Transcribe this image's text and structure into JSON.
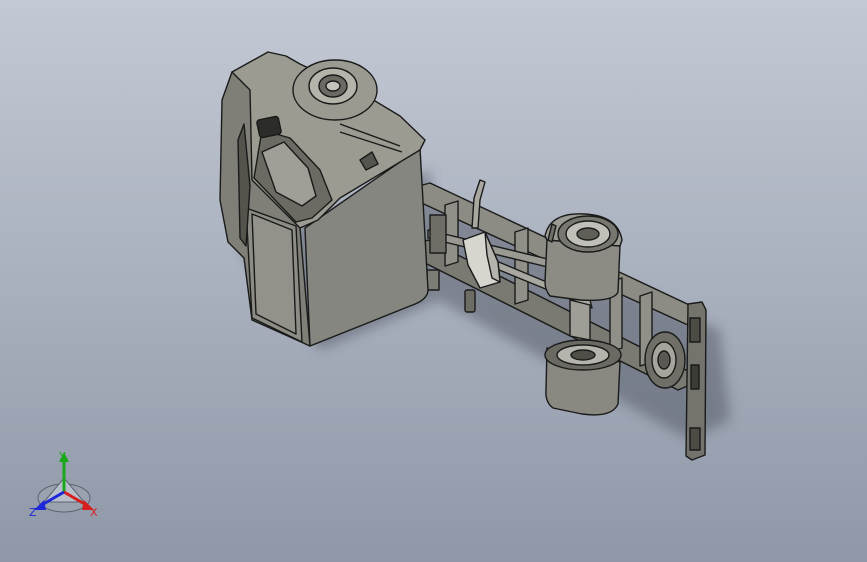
{
  "viewport": {
    "background_top": "#c3c9d4",
    "background_bottom": "#8f98a8"
  },
  "model": {
    "body_color": "#8a8a80",
    "body_light": "#9d9d93",
    "body_dark": "#5f5f57",
    "edge_color": "#1a1a1a"
  },
  "triad": {
    "x_label": "X",
    "y_label": "Y",
    "z_label": "Z",
    "x_color": "#d62020",
    "y_color": "#1aa81a",
    "z_color": "#1e28d8"
  }
}
